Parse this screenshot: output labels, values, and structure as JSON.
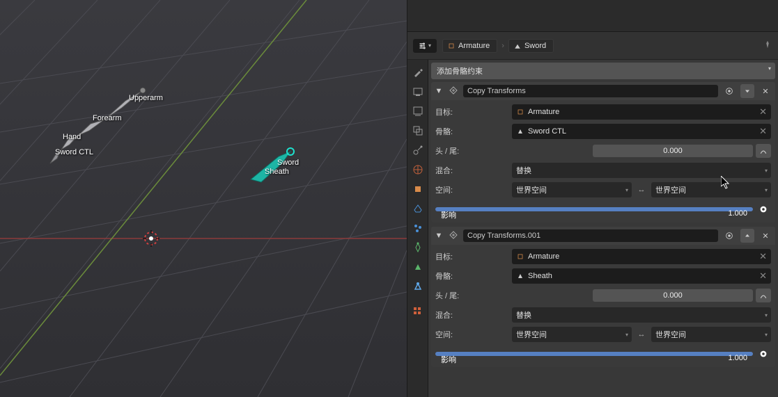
{
  "breadcrumb": {
    "armature": "Armature",
    "bone": "Sword"
  },
  "add_constraint": "添加骨骼约束",
  "viewport_bones": {
    "upperarm": "Upperarm",
    "forearm": "Forearm",
    "hand": "Hand",
    "sword_ctl": "Sword CTL",
    "sword": "Sword",
    "sheath": "Sheath"
  },
  "labels": {
    "target": "目标:",
    "bone": "骨骼:",
    "head_tail": "头 / 尾:",
    "mix": "混合:",
    "space": "空间:",
    "influence": "影响"
  },
  "constraints": [
    {
      "name": "Copy Transforms",
      "target": "Armature",
      "bone": "Sword CTL",
      "head_tail": "0.000",
      "mix": "替换",
      "space_from": "世界空间",
      "space_to": "世界空间",
      "influence": "1.000",
      "move_dir": "down"
    },
    {
      "name": "Copy Transforms.001",
      "target": "Armature",
      "bone": "Sheath",
      "head_tail": "0.000",
      "mix": "替换",
      "space_from": "世界空间",
      "space_to": "世界空间",
      "influence": "1.000",
      "move_dir": "up"
    }
  ]
}
